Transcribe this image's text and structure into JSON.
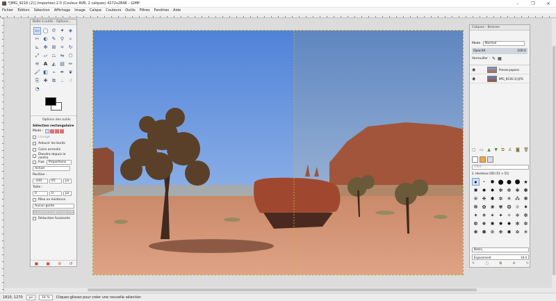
{
  "window": {
    "title": "*[IMG_9216 (2)] (importée)-2.0 (Couleur RVB, 2 calques) 4272x2848 – GIMP",
    "controls": [
      "–",
      "❐",
      "✕"
    ]
  },
  "menu": [
    "Fichier",
    "Édition",
    "Sélection",
    "Affichage",
    "Image",
    "Calque",
    "Couleurs",
    "Outils",
    "Filtres",
    "Fenêtres",
    "Aide"
  ],
  "toolbox": {
    "title": "Boîte à outils - Options...",
    "fg_color": "#000000",
    "bg_color": "#ffffff",
    "options_tab": "Options des outils",
    "section": "Sélection rectangulaire",
    "mode_label": "Mode :",
    "lissage": "Lissage",
    "adoucir": "Adoucir les bords",
    "coins": "Coins arrondis",
    "etendre": "Étendre depuis le centre",
    "fixe_label": "Fixe",
    "fixe_value": "Proportions",
    "ratio_value": "Actuel",
    "position_label": "Position :",
    "position_x": "-330",
    "position_y": "65",
    "position_unit": "px",
    "taille_label": "Taille :",
    "taille_w": "0",
    "taille_h": "0",
    "taille_unit": "px",
    "mise_en_evidence": "Mise en évidence",
    "guide": "Aucun guide",
    "auto_button": "Rétrécissement automatique",
    "reduction": "Réduction fusionnée"
  },
  "layers_panel": {
    "title": "Calques - Brosses",
    "mode_label": "Mode",
    "mode_value": "Normal",
    "opacity_label": "Opacité",
    "opacity_value": "100.0",
    "lock_label": "Verrouiller :",
    "layers": [
      {
        "name": "Presse-papiers"
      },
      {
        "name": "IMG_9216 (2).JPG"
      }
    ],
    "brush_filter": "Filtre",
    "brush_name": "2. Hardness 050 (51 × 51)",
    "brush_tag": "Basic,",
    "spacing_label": "Espacement",
    "spacing_value": "10.0"
  },
  "status": {
    "coords": "1810, 1270",
    "unit": "px",
    "zoom": "16 %",
    "message": "Cliquez-glissez pour créer une nouvelle sélection"
  },
  "icons": {
    "window_app": "gimp-icon",
    "tools": [
      "rect-select-icon",
      "ellipse-select-icon",
      "lasso-icon",
      "fuzzy-select-icon",
      "color-select-icon",
      "scissors-icon",
      "foreground-select-icon",
      "paths-icon",
      "color-picker-icon",
      "zoom-icon",
      "measure-icon",
      "move-icon",
      "align-icon",
      "crop-icon",
      "rotate-icon",
      "scale-icon",
      "shear-icon",
      "perspective-icon",
      "flip-icon",
      "cage-icon",
      "warp-icon",
      "text-icon",
      "bucket-fill-icon",
      "blend-icon",
      "pencil-icon",
      "paintbrush-icon",
      "eraser-icon",
      "airbrush-icon",
      "ink-icon",
      "mypaint-icon",
      "clone-icon",
      "heal-icon",
      "perspective-clone-icon",
      "blur-icon",
      "smudge-icon",
      "dodge-icon"
    ]
  }
}
